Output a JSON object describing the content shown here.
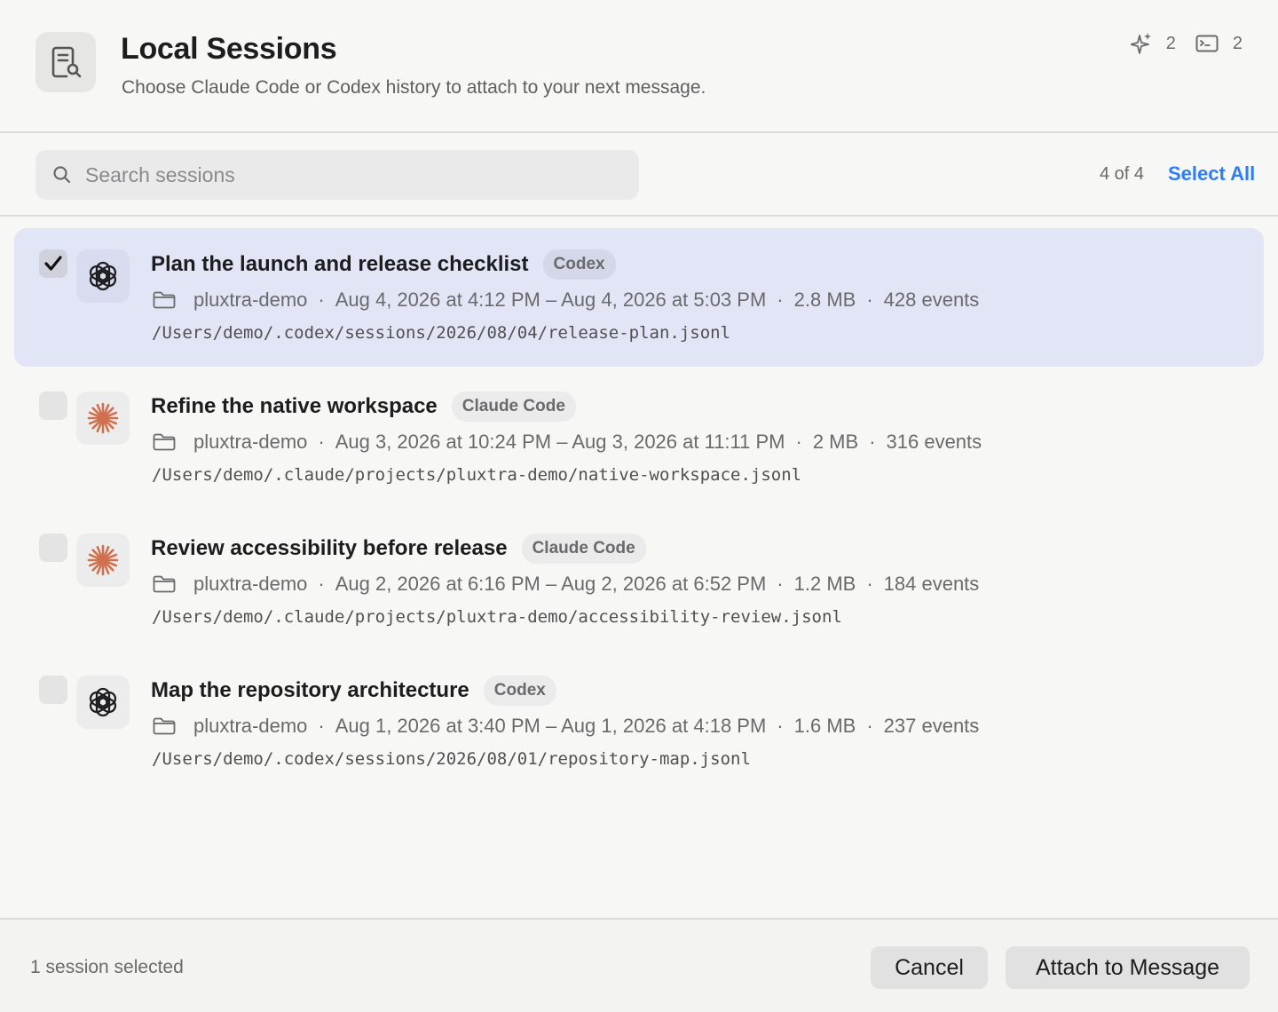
{
  "header": {
    "icon": "document-search-icon",
    "title": "Local Sessions",
    "subtitle": "Choose Claude Code or Codex history to attach to your next message.",
    "counts": [
      {
        "icon": "sparkle-icon",
        "value": "2"
      },
      {
        "icon": "terminal-icon",
        "value": "2"
      }
    ]
  },
  "search": {
    "placeholder": "Search sessions",
    "value": "",
    "count_text": "4 of 4",
    "select_all_label": "Select All"
  },
  "sessions": [
    {
      "title": "Plan the launch and release checklist",
      "source": "Codex",
      "source_icon": "openai-icon",
      "selected": true,
      "project": "pluxtra-demo",
      "time_range": "Aug 4, 2026 at 4:12 PM – Aug 4, 2026 at 5:03 PM",
      "size": "2.8 MB",
      "events": "428 events",
      "path": "/Users/demo/.codex/sessions/2026/08/04/release-plan.jsonl"
    },
    {
      "title": "Refine the native workspace",
      "source": "Claude Code",
      "source_icon": "claude-icon",
      "selected": false,
      "project": "pluxtra-demo",
      "time_range": "Aug 3, 2026 at 10:24 PM – Aug 3, 2026 at 11:11 PM",
      "size": "2 MB",
      "events": "316 events",
      "path": "/Users/demo/.claude/projects/pluxtra-demo/native-workspace.jsonl"
    },
    {
      "title": "Review accessibility before release",
      "source": "Claude Code",
      "source_icon": "claude-icon",
      "selected": false,
      "project": "pluxtra-demo",
      "time_range": "Aug 2, 2026 at 6:16 PM – Aug 2, 2026 at 6:52 PM",
      "size": "1.2 MB",
      "events": "184 events",
      "path": "/Users/demo/.claude/projects/pluxtra-demo/accessibility-review.jsonl"
    },
    {
      "title": "Map the repository architecture",
      "source": "Codex",
      "source_icon": "openai-icon",
      "selected": false,
      "project": "pluxtra-demo",
      "time_range": "Aug 1, 2026 at 3:40 PM – Aug 1, 2026 at 4:18 PM",
      "size": "1.6 MB",
      "events": "237 events",
      "path": "/Users/demo/.codex/sessions/2026/08/01/repository-map.jsonl"
    }
  ],
  "separator": "·",
  "footer": {
    "status": "1 session selected",
    "cancel_label": "Cancel",
    "attach_label": "Attach to Message"
  },
  "colors": {
    "accent": "#2f7cf6",
    "selected_row": "#e1e5f6",
    "claude_orange": "#d0704f"
  }
}
